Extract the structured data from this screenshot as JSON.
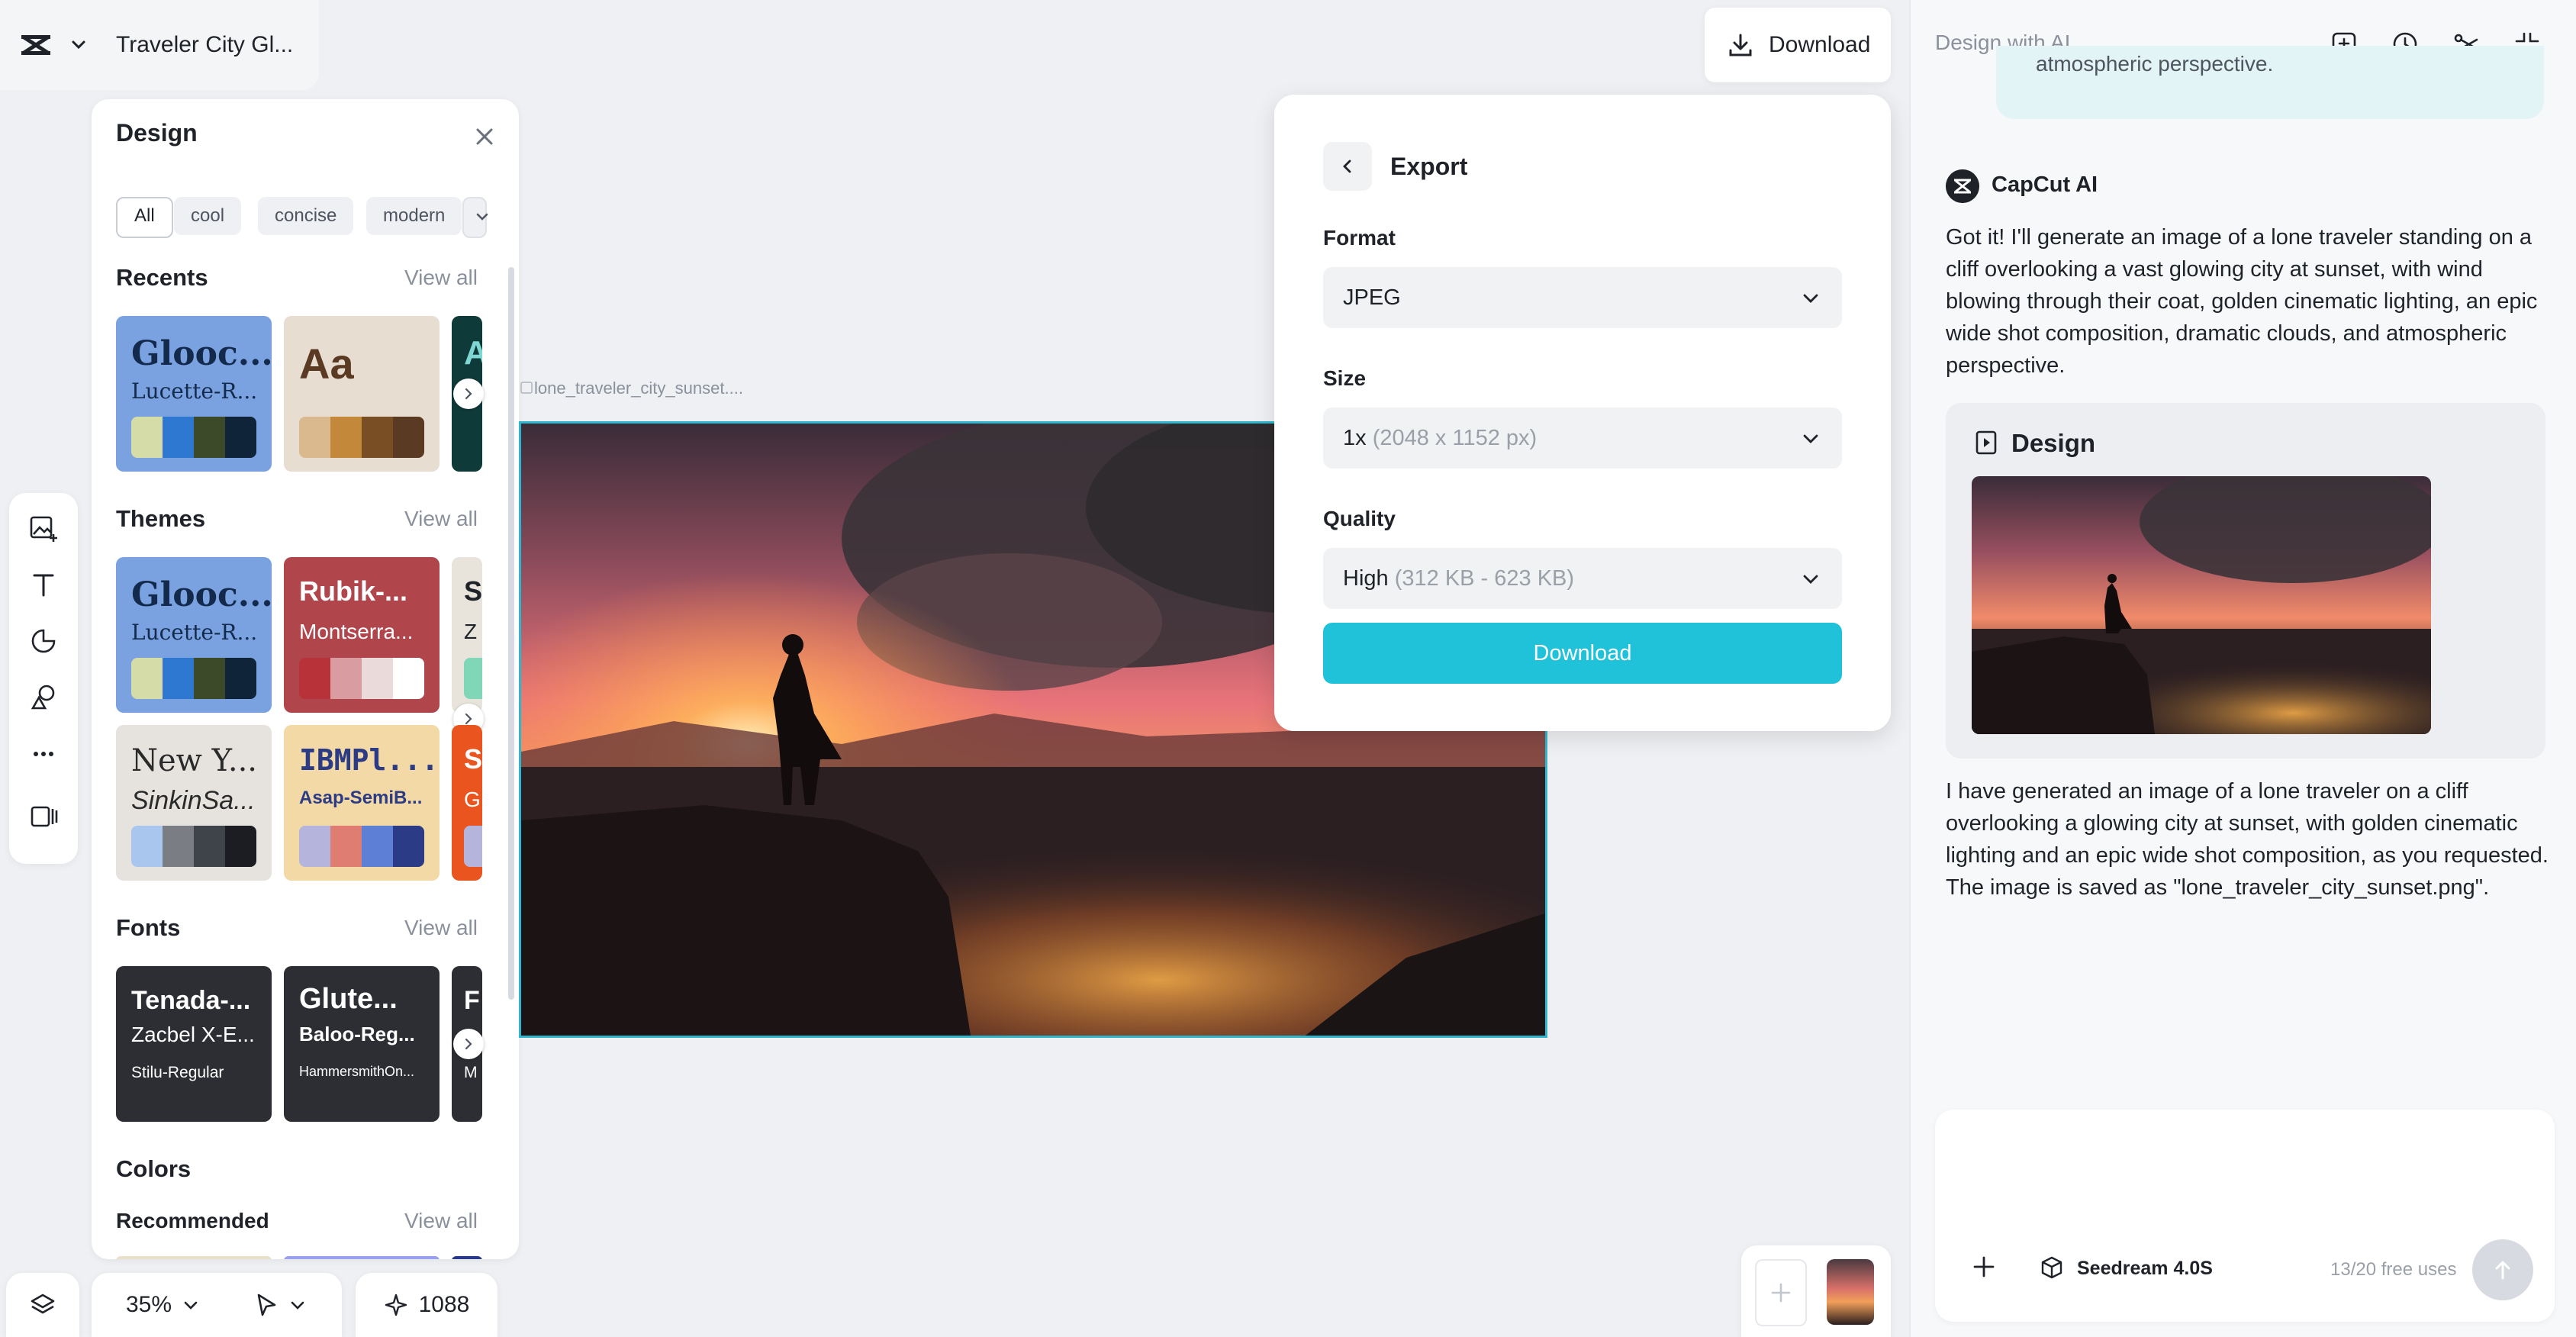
{
  "header": {
    "doc_title": "Traveler City Gl..."
  },
  "design_panel": {
    "title": "Design",
    "filters": [
      "All",
      "cool",
      "concise",
      "modern"
    ],
    "recents": {
      "title": "Recents",
      "view_all": "View all",
      "tiles": [
        {
          "big": "Glooc...",
          "small": "Lucette-R...",
          "swatches": [
            "#d6dca7",
            "#2f78d1",
            "#3d4a2a",
            "#0f2438"
          ]
        },
        {
          "big": "Aa",
          "small": "",
          "swatches": [
            "#dab98f",
            "#c4883a",
            "#7a4e25",
            "#5a3a22"
          ]
        },
        {
          "big": "A",
          "small": "",
          "swatches": []
        }
      ]
    },
    "themes": {
      "title": "Themes",
      "view_all": "View all",
      "tiles": [
        {
          "big": "Glooc...",
          "small": "Lucette-R...",
          "swatches": [
            "#d6dca7",
            "#2f78d1",
            "#3d4a2a",
            "#0f2438"
          ]
        },
        {
          "big": "Rubik-...",
          "small": "Montserra...",
          "swatches": [
            "#b8323a",
            "#d99ca0",
            "#eadada",
            "#ffffff"
          ]
        },
        {
          "big": "S",
          "small": "Z",
          "swatches": []
        },
        {
          "big": "New Y...",
          "small": "SinkinSa...",
          "swatches": [
            "#a9c7ee",
            "#7a7d83",
            "#3f444b",
            "#1b1d22"
          ]
        },
        {
          "big": "IBMPl...",
          "small": "Asap-SemiB...",
          "swatches": [
            "#b5b4dc",
            "#e07d73",
            "#5d7fd6",
            "#2b3b85"
          ]
        },
        {
          "big": "S",
          "small": "G",
          "swatches": []
        }
      ]
    },
    "fonts": {
      "title": "Fonts",
      "view_all": "View all",
      "tiles": [
        {
          "l1": "Tenada-...",
          "l2": "Zacbel X-E...",
          "l3": "Stilu-Regular"
        },
        {
          "l1": "Glute...",
          "l2": "Baloo-Reg...",
          "l3": "HammersmithOn..."
        },
        {
          "l1": "F",
          "l2": "",
          "l3": "M"
        }
      ]
    },
    "colors": {
      "title": "Colors",
      "recommended": "Recommended",
      "view_all": "View all"
    }
  },
  "bottom": {
    "zoom": "35%",
    "credits": "1088"
  },
  "canvas": {
    "file_label": "lone_traveler_city_sunset...."
  },
  "download_top": {
    "label": "Download"
  },
  "export": {
    "title": "Export",
    "format_label": "Format",
    "format_value": "JPEG",
    "size_label": "Size",
    "size_value": "1x",
    "size_sub": "(2048 x 1152 px)",
    "quality_label": "Quality",
    "quality_value": "High",
    "quality_sub": "(312 KB - 623 KB)",
    "download_label": "Download"
  },
  "ai_panel": {
    "title": "Design with AI",
    "bubble_text": "atmospheric perspective.",
    "assistant_name": "CapCut AI",
    "message1": "Got it! I'll generate an image of a lone traveler standing on a cliff overlooking a vast glowing city at sunset, with wind blowing through their coat, golden cinematic lighting, an epic wide shot composition, dramatic clouds, and atmospheric perspective.",
    "design_card_title": "Design",
    "message2": "I have generated an image of a lone traveler on a cliff overlooking a glowing city at sunset, with golden cinematic lighting and an epic wide shot composition, as you requested. The image is saved as \"lone_traveler_city_sunset.png\".",
    "model_name": "Seedream 4.0S",
    "usage": "13/20 free uses"
  },
  "colors": {
    "accent": "#1fc2d8",
    "selection": "#2fb6cc"
  }
}
